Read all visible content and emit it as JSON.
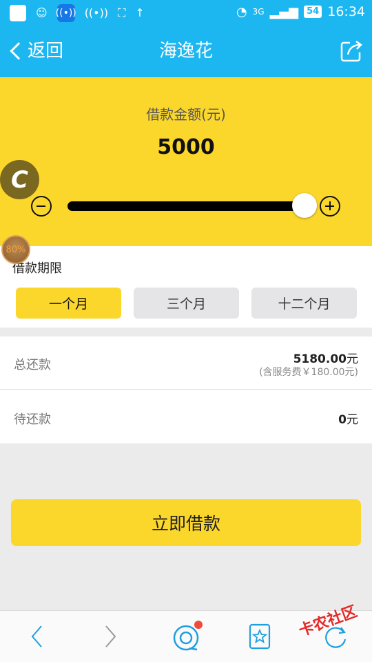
{
  "status_bar": {
    "battery": "54",
    "time": "16:34",
    "network": "3G"
  },
  "header": {
    "back_label": "返回",
    "title": "海逸花"
  },
  "loan_amount": {
    "label": "借款金额(元)",
    "value": "5000",
    "slider_fraction": 1.0
  },
  "floating": {
    "badge_percent": "80%"
  },
  "term": {
    "label": "借款期限",
    "options": [
      "一个月",
      "三个月",
      "十二个月"
    ],
    "selected": "一个月"
  },
  "repayment": {
    "total_label": "总还款",
    "total_value": "5180.00",
    "total_unit": "元",
    "total_note": "(含服务费￥180.00元)",
    "pending_label": "待还款",
    "pending_value": "0",
    "pending_unit": "元"
  },
  "action": {
    "loan_button": "立即借款"
  },
  "watermark": "卡农社区",
  "colors": {
    "header_blue": "#1cb7f0",
    "accent_yellow": "#fcd72b",
    "bottom_icon_blue": "#1e9fe0",
    "notify_red": "#f04a3a"
  },
  "icons": [
    "back-chevron-icon",
    "share-icon",
    "minus-circle-icon",
    "plus-circle-icon",
    "nav-back-icon",
    "nav-forward-icon",
    "home-icon",
    "bookmark-star-icon",
    "refresh-icon"
  ]
}
